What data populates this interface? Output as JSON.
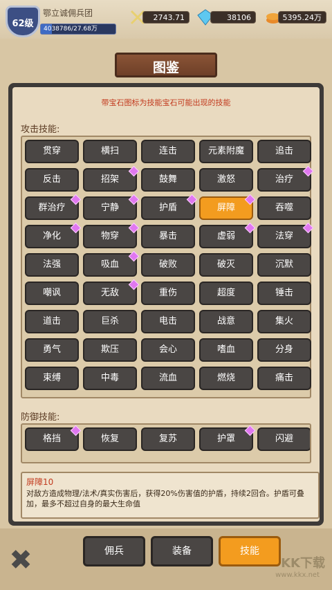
{
  "header": {
    "level": "62级",
    "guild_name": "鄂立诚佣兵团",
    "exp_text": "4038786/27.68万",
    "exp_fraction": 0.146,
    "attack_value": "2743.71",
    "gems_value": "38106",
    "gold_value": "5395.24万"
  },
  "title": "图鉴",
  "notice": "带宝石图标为技能宝石可能出现的技能",
  "attack_section": {
    "label": "攻击技能:",
    "rows": [
      [
        {
          "name": "贯穿",
          "gem": false
        },
        {
          "name": "横扫",
          "gem": false
        },
        {
          "name": "连击",
          "gem": false
        },
        {
          "name": "元素附魔",
          "gem": false
        },
        {
          "name": "追击",
          "gem": false
        }
      ],
      [
        {
          "name": "反击",
          "gem": false
        },
        {
          "name": "招架",
          "gem": true
        },
        {
          "name": "鼓舞",
          "gem": false
        },
        {
          "name": "激怒",
          "gem": false
        },
        {
          "name": "治疗",
          "gem": true
        }
      ],
      [
        {
          "name": "群治疗",
          "gem": true
        },
        {
          "name": "宁静",
          "gem": true
        },
        {
          "name": "护盾",
          "gem": true
        },
        {
          "name": "屏障",
          "gem": true,
          "selected": true
        },
        {
          "name": "吞噬",
          "gem": false
        }
      ],
      [
        {
          "name": "净化",
          "gem": true
        },
        {
          "name": "物穿",
          "gem": true
        },
        {
          "name": "暴击",
          "gem": false
        },
        {
          "name": "虚弱",
          "gem": true
        },
        {
          "name": "法穿",
          "gem": true
        }
      ],
      [
        {
          "name": "法强",
          "gem": false
        },
        {
          "name": "吸血",
          "gem": true
        },
        {
          "name": "破败",
          "gem": false
        },
        {
          "name": "破灭",
          "gem": false
        },
        {
          "name": "沉默",
          "gem": false
        }
      ],
      [
        {
          "name": "嘲讽",
          "gem": false
        },
        {
          "name": "无敌",
          "gem": true
        },
        {
          "name": "重伤",
          "gem": false
        },
        {
          "name": "超度",
          "gem": false
        },
        {
          "name": "锤击",
          "gem": false
        }
      ],
      [
        {
          "name": "道击",
          "gem": false
        },
        {
          "name": "巨杀",
          "gem": false
        },
        {
          "name": "电击",
          "gem": false
        },
        {
          "name": "战意",
          "gem": false
        },
        {
          "name": "集火",
          "gem": false
        }
      ],
      [
        {
          "name": "勇气",
          "gem": false
        },
        {
          "name": "欺压",
          "gem": false
        },
        {
          "name": "会心",
          "gem": false
        },
        {
          "name": "嗜血",
          "gem": false
        },
        {
          "name": "分身",
          "gem": false
        }
      ],
      [
        {
          "name": "束缚",
          "gem": false
        },
        {
          "name": "中毒",
          "gem": false
        },
        {
          "name": "流血",
          "gem": false
        },
        {
          "name": "燃烧",
          "gem": false
        },
        {
          "name": "痛击",
          "gem": false
        }
      ]
    ]
  },
  "defense_section": {
    "label": "防御技能:",
    "rows": [
      [
        {
          "name": "格挡",
          "gem": true
        },
        {
          "name": "恢复",
          "gem": false
        },
        {
          "name": "复苏",
          "gem": false
        },
        {
          "name": "护罩",
          "gem": true
        },
        {
          "name": "闪避",
          "gem": false
        }
      ]
    ]
  },
  "description": {
    "title": "屏障10",
    "text": "对敌方造成物理/法术/真实伤害后，获得20%伤害值的护盾，持续2回合。护盾可叠加，最多不超过自身的最大生命值"
  },
  "bottom_tabs": [
    {
      "label": "佣兵",
      "active": false
    },
    {
      "label": "装备",
      "active": false
    },
    {
      "label": "技能",
      "active": true
    }
  ],
  "watermark": {
    "main": "KK下载",
    "sub": "www.kkx.net"
  },
  "colors": {
    "accent": "#f39c1f",
    "button": "#4a4644",
    "notice": "#c23a1e",
    "gem": "#e078f0"
  }
}
